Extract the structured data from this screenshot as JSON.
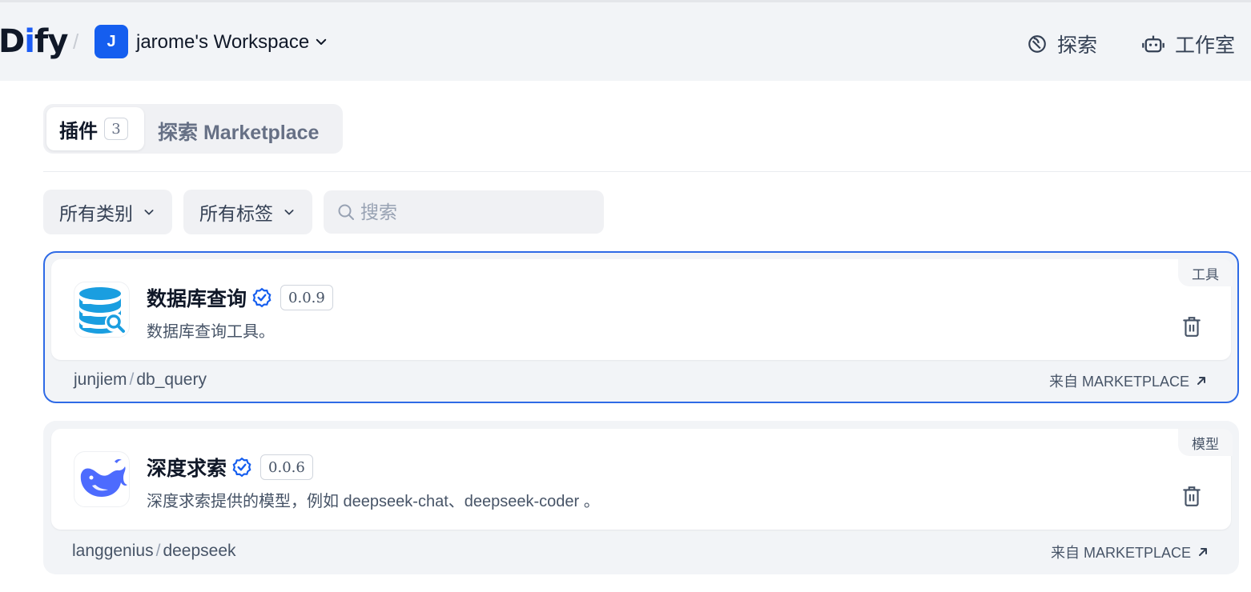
{
  "header": {
    "logo": {
      "d": "D",
      "i": "i",
      "fy": "fy"
    },
    "separator": "/",
    "workspace": {
      "avatar_letter": "J",
      "name": "jarome's Workspace"
    },
    "nav": [
      {
        "label": "探索",
        "icon": "compass-icon"
      },
      {
        "label": "工作室",
        "icon": "robot-icon"
      }
    ]
  },
  "tabs": {
    "plugins_label": "插件",
    "plugins_count": "3",
    "marketplace_label": "探索 Marketplace"
  },
  "filters": {
    "category_label": "所有类别",
    "tag_label": "所有标签",
    "search_placeholder": "搜索"
  },
  "plugins": [
    {
      "name": "数据库查询",
      "version": "0.0.9",
      "description": "数据库查询工具。",
      "type_tag": "工具",
      "author": "junjiem",
      "slug": "db_query",
      "source": "来自 MARKETPLACE",
      "icon": "database-search-icon"
    },
    {
      "name": "深度求索",
      "version": "0.0.6",
      "description": "深度求索提供的模型，例如 deepseek-chat、deepseek-coder 。",
      "type_tag": "模型",
      "author": "langgenius",
      "slug": "deepseek",
      "source": "来自 MARKETPLACE",
      "icon": "whale-icon"
    }
  ],
  "colors": {
    "accent": "#155eef",
    "selected_border": "#2e6ae6",
    "deepseek_blue": "#4d6bfe",
    "db_blue": "#1a9ee0"
  }
}
